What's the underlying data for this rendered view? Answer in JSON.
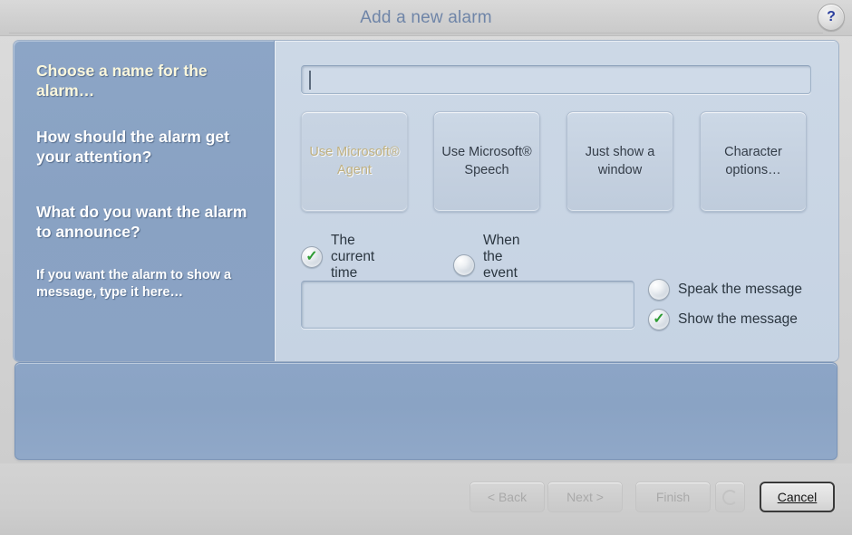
{
  "window": {
    "title": "Add a new alarm",
    "help_icon": "help-question-icon",
    "help_label": "?"
  },
  "sidebar": {
    "steps": [
      {
        "text": "Choose a name for the alarm…",
        "state": "active",
        "kind": "heading"
      },
      {
        "text": "How should the alarm get your attention?",
        "state": "normal",
        "kind": "heading"
      },
      {
        "text": "What do you want the alarm to announce?",
        "state": "normal",
        "kind": "heading"
      },
      {
        "text": "If you want the alarm to show a message, type it here…",
        "state": "normal",
        "kind": "subtext"
      }
    ]
  },
  "content": {
    "name_field": {
      "value": "",
      "placeholder": "",
      "has_caret": true
    },
    "attention_tiles": [
      {
        "label": "Use Microsoft® Agent",
        "disabled": true
      },
      {
        "label": "Use Microsoft® Speech",
        "disabled": false
      },
      {
        "label": "Just show a window",
        "disabled": false
      },
      {
        "label": "Character options…",
        "disabled": false
      }
    ],
    "announce_options": [
      {
        "label": "The current time",
        "selected": true,
        "icon": "radio-checked-icon"
      },
      {
        "label": "When the event happens",
        "selected": false,
        "icon": "radio-unchecked-icon"
      }
    ],
    "message_field": {
      "value": "",
      "placeholder": ""
    },
    "message_options": [
      {
        "label": "Speak the message",
        "selected": false,
        "icon": "radio-unchecked-icon"
      },
      {
        "label": "Show the message",
        "selected": true,
        "icon": "radio-checked-icon"
      }
    ]
  },
  "preview_panel": {
    "content": ""
  },
  "footer": {
    "buttons": [
      {
        "label": "< Back",
        "disabled": true,
        "name": "back-button"
      },
      {
        "label": "Next >",
        "disabled": true,
        "name": "next-button"
      },
      {
        "label": "Finish",
        "disabled": true,
        "name": "finish-button"
      },
      {
        "label": "",
        "disabled": true,
        "name": "play-preview-button",
        "icon": "refresh-circle-icon"
      },
      {
        "label": "Cancel",
        "disabled": false,
        "name": "cancel-button"
      }
    ]
  },
  "colors": {
    "title_text": "#6f85a8",
    "sidebar_blue": "#8ca5c6",
    "content_blue": "#ccd8e6",
    "window_gray": "#d2d2d2",
    "active_step_text": "#fbf7dc",
    "disabled_tile_text": "#c0b181",
    "check_green": "#2e9c34",
    "help_blue": "#2b3f9e"
  }
}
